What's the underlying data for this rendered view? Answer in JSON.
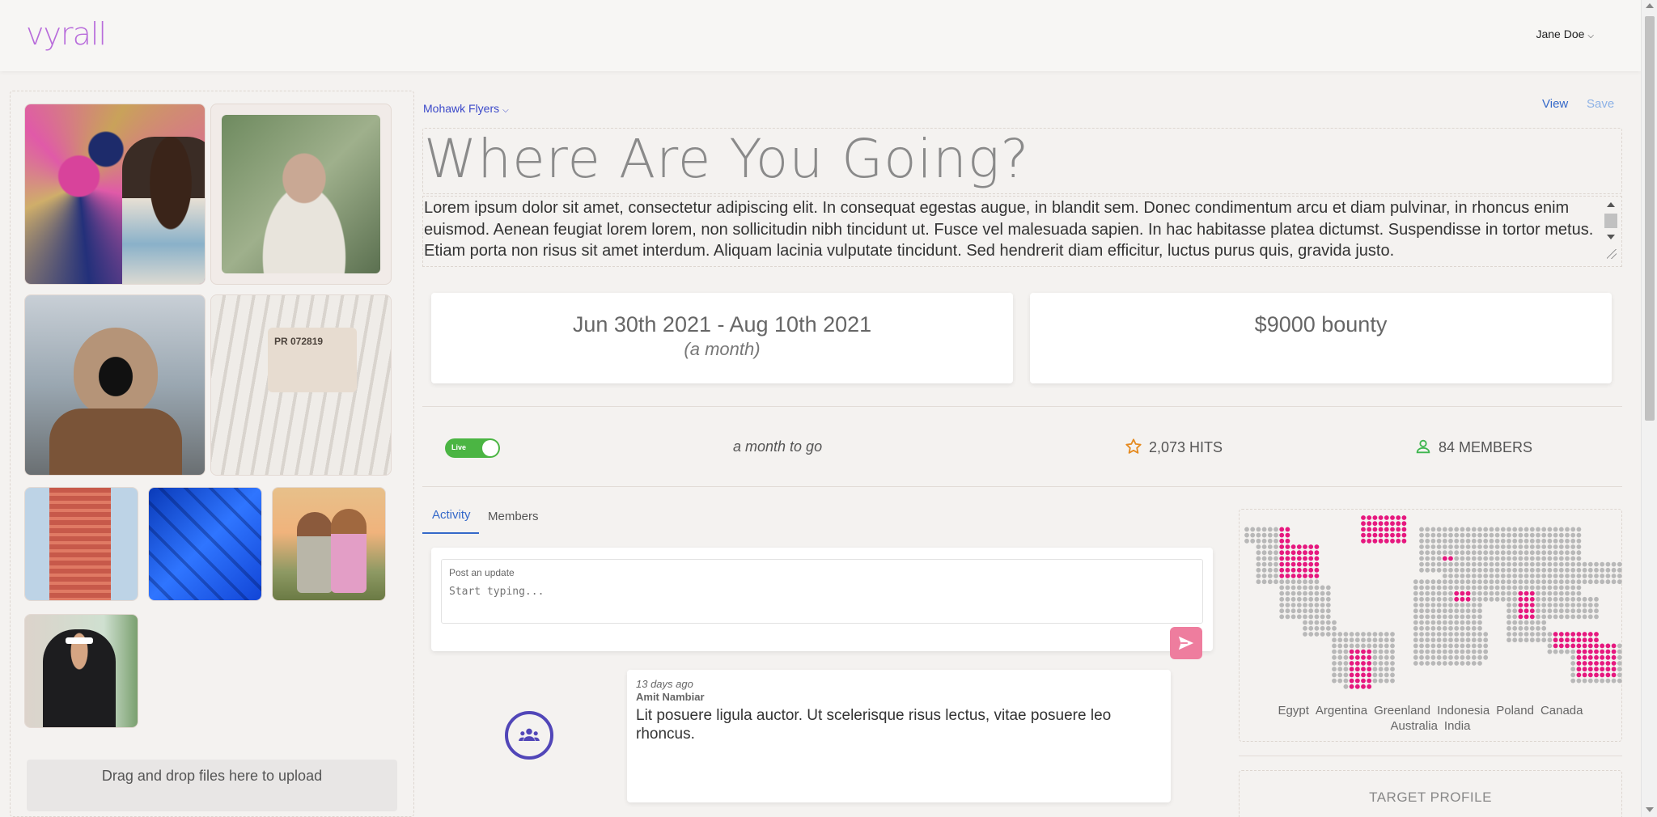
{
  "app": {
    "logo": "vyrall",
    "user_name": "Jane Doe"
  },
  "campaign": {
    "team": "Mohawk Flyers",
    "view_label": "View",
    "save_label": "Save",
    "title": "Where Are You Going?",
    "description": "Lorem ipsum dolor sit amet, consectetur adipiscing elit. In consequat egestas augue, in blandit sem. Donec condimentum arcu et diam pulvinar, in rhoncus enim euismod. Aenean feugiat lorem lorem, non sollicitudin nibh tincidunt ut. Fusce vel malesuada sapien. In hac habitasse platea dictumst. Suspendisse in tortor metus. Etiam porta non risus sit amet interdum. Aliquam lacinia vulputate tincidunt. Sed hendrerit diam efficitur, luctus purus quis, gravida justo.",
    "date_range": "Jun 30th 2021 - Aug 10th 2021",
    "duration": "(a month)",
    "bounty": "$9000 bounty"
  },
  "stats": {
    "live_label": "Live",
    "time_left": "a month to go",
    "hits": "2,073 HITS",
    "members": "84 MEMBERS"
  },
  "tabs": {
    "activity": "Activity",
    "members": "Members"
  },
  "post": {
    "label": "Post an update",
    "placeholder": "Start typing..."
  },
  "feed": [
    {
      "when": "13 days ago",
      "author": "Amit Nambiar",
      "text": "Lit posuere ligula auctor. Ut scelerisque risus lectus, vitae posuere leo rhoncus."
    }
  ],
  "map": {
    "countries_line1": [
      "Egypt",
      "Argentina",
      "Greenland",
      "Indonesia",
      "Poland",
      "Canada"
    ],
    "countries_line2": [
      "Australia",
      "India"
    ],
    "highlight_color": "#e6187f",
    "base_color": "#b8b8b8"
  },
  "target_profile": {
    "title": "TARGET PROFILE"
  },
  "uploads": {
    "dropzone": "Drag and drop files here to upload"
  },
  "icons": [
    "chevron-down-icon",
    "star-icon",
    "person-icon",
    "send-icon",
    "group-icon"
  ]
}
